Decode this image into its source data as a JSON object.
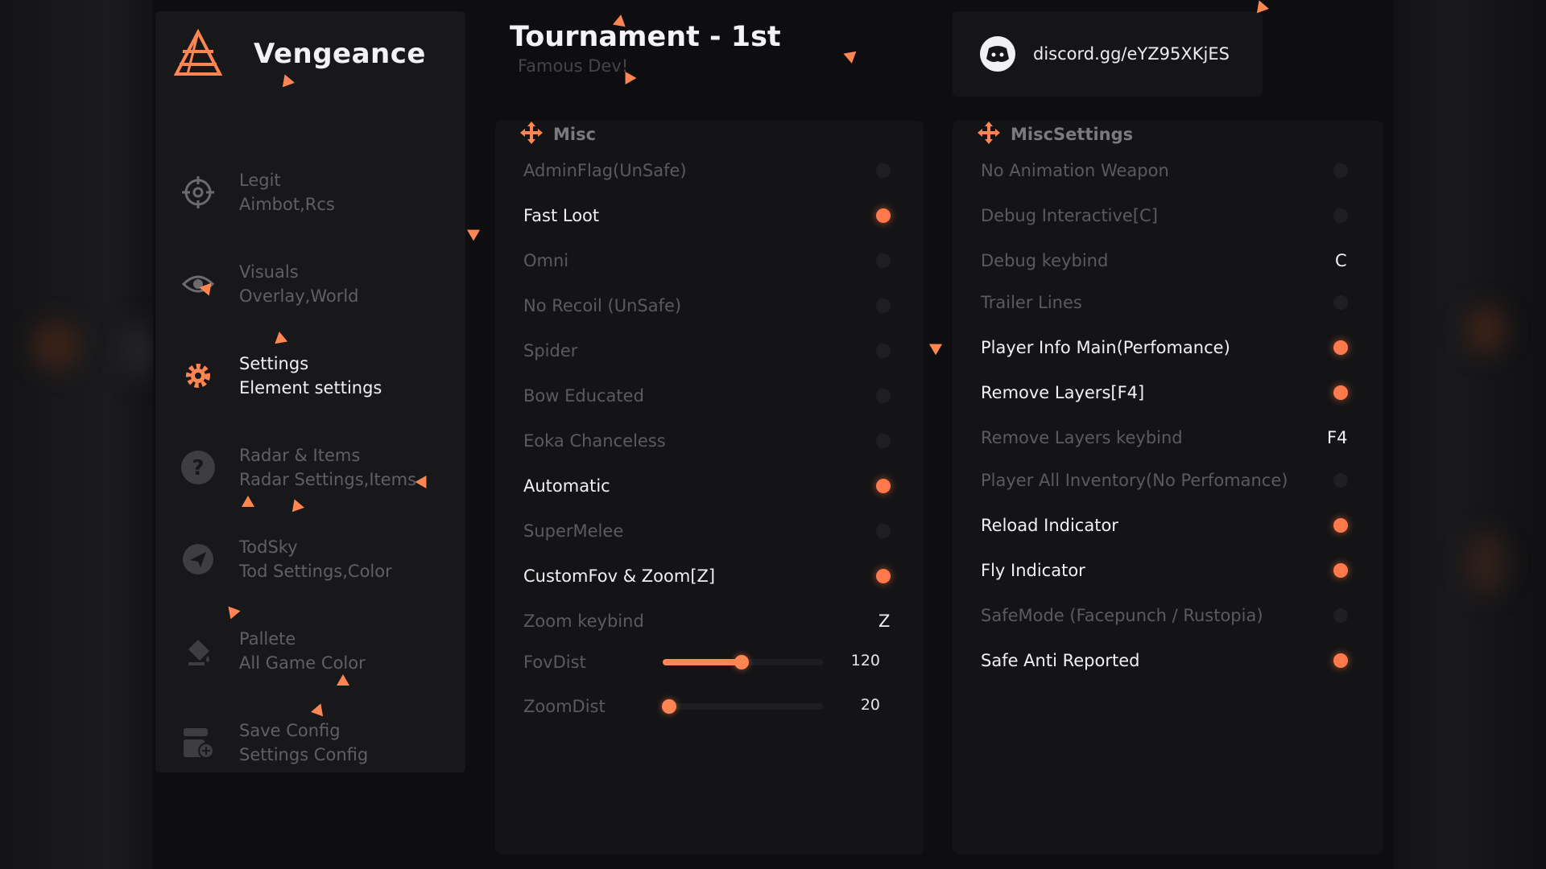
{
  "brand": {
    "name": "Vengeance"
  },
  "header": {
    "title": "Tournament - 1st",
    "subtitle": "Famous Dev!"
  },
  "discord": {
    "text": "discord.gg/eYZ95XKjES"
  },
  "colors": {
    "accent": "#ff7a4a",
    "panel": "#141416",
    "sidebar": "#18181b"
  },
  "sidebar": {
    "items": [
      {
        "title": "Legit",
        "sub": "Aimbot,Rcs",
        "icon": "crosshair-icon"
      },
      {
        "title": "Visuals",
        "sub": "Overlay,World",
        "icon": "eye-icon"
      },
      {
        "title": "Settings",
        "sub": "Element settings",
        "icon": "gear-icon",
        "active": true
      },
      {
        "title": "Radar & Items",
        "sub": "Radar Settings,Items",
        "icon": "question-icon"
      },
      {
        "title": "TodSky",
        "sub": "Tod Settings,Color",
        "icon": "paper-plane-icon"
      },
      {
        "title": "Pallete",
        "sub": "All Game Color",
        "icon": "paint-bucket-icon"
      },
      {
        "title": "Save Config",
        "sub": "Settings Config",
        "icon": "save-config-icon"
      }
    ]
  },
  "misc": {
    "label": "Misc",
    "rows": [
      {
        "label": "AdminFlag(UnSafe)",
        "type": "toggle",
        "on": false
      },
      {
        "label": "Fast Loot",
        "type": "toggle",
        "on": true
      },
      {
        "label": "Omni",
        "type": "toggle",
        "on": false
      },
      {
        "label": "No Recoil (UnSafe)",
        "type": "toggle",
        "on": false
      },
      {
        "label": "Spider",
        "type": "toggle",
        "on": false
      },
      {
        "label": "Bow Educated",
        "type": "toggle",
        "on": false
      },
      {
        "label": "Eoka Chanceless",
        "type": "toggle",
        "on": false
      },
      {
        "label": "Automatic",
        "type": "toggle",
        "on": true
      },
      {
        "label": "SuperMelee",
        "type": "toggle",
        "on": false
      },
      {
        "label": "CustomFov & Zoom[Z]",
        "type": "toggle",
        "on": true
      },
      {
        "label": "Zoom keybind",
        "type": "keybind",
        "value": "Z"
      },
      {
        "label": "FovDist",
        "type": "slider",
        "value": "120",
        "fraction": 0.49
      },
      {
        "label": "ZoomDist",
        "type": "slider",
        "value": "20",
        "fraction": 0.04
      }
    ]
  },
  "miscsettings": {
    "label": "MiscSettings",
    "rows": [
      {
        "label": "No Animation Weapon",
        "type": "toggle",
        "on": false
      },
      {
        "label": "Debug Interactive[C]",
        "type": "toggle",
        "on": false
      },
      {
        "label": "Debug keybind",
        "type": "keybind",
        "value": "C"
      },
      {
        "label": "Trailer Lines",
        "type": "toggle",
        "on": false
      },
      {
        "label": "Player Info Main(Perfomance)",
        "type": "toggle",
        "on": true
      },
      {
        "label": "Remove Layers[F4]",
        "type": "toggle",
        "on": true
      },
      {
        "label": "Remove Layers keybind",
        "type": "keybind",
        "value": "F4"
      },
      {
        "label": "Player All Inventory(No Perfomance)",
        "type": "toggle",
        "on": false
      },
      {
        "label": "Reload Indicator",
        "type": "toggle",
        "on": true
      },
      {
        "label": "Fly Indicator",
        "type": "toggle",
        "on": true
      },
      {
        "label": "SafeMode (Facepunch / Rustopia)",
        "type": "toggle",
        "on": false
      },
      {
        "label": "Safe Anti Reported",
        "type": "toggle",
        "on": true
      }
    ]
  }
}
